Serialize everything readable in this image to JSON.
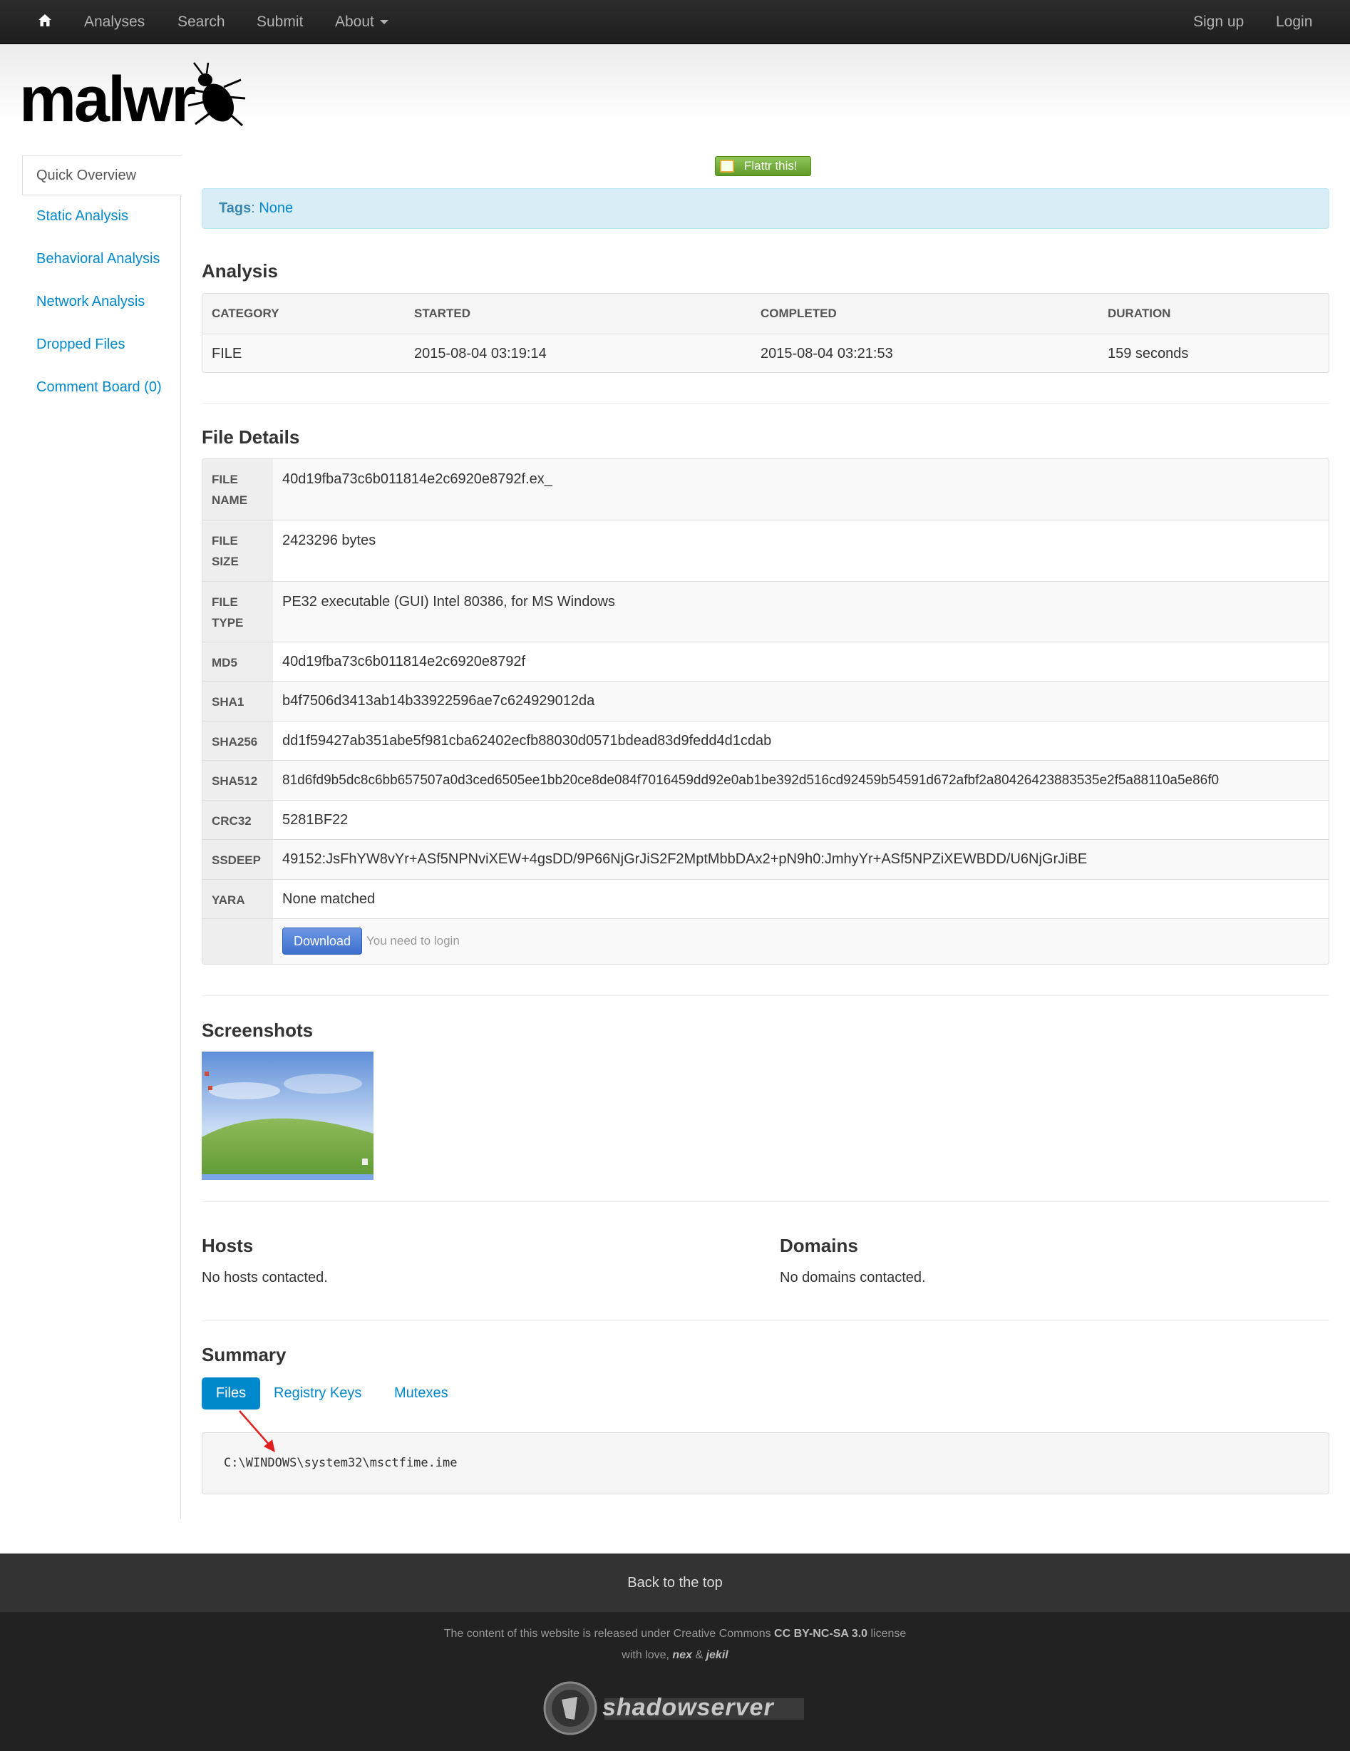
{
  "nav": {
    "left": [
      "Analyses",
      "Search",
      "Submit",
      "About"
    ],
    "right": [
      "Sign up",
      "Login"
    ]
  },
  "logo": {
    "text": "malwr"
  },
  "sidebar": {
    "active": "Quick Overview",
    "items": [
      "Static Analysis",
      "Behavioral Analysis",
      "Network Analysis",
      "Dropped Files",
      "Comment Board (0)"
    ]
  },
  "flattr": {
    "label": "Flattr this!"
  },
  "tags": {
    "label": "Tags",
    "value": "None"
  },
  "analysis": {
    "title": "Analysis",
    "headers": [
      "CATEGORY",
      "STARTED",
      "COMPLETED",
      "DURATION"
    ],
    "row": [
      "FILE",
      "2015-08-04 03:19:14",
      "2015-08-04 03:21:53",
      "159 seconds"
    ]
  },
  "file_details": {
    "title": "File Details",
    "file_name_label": [
      "FILE",
      "NAME"
    ],
    "file_name": "40d19fba73c6b011814e2c6920e8792f.ex_",
    "file_size_label": [
      "FILE",
      "SIZE"
    ],
    "file_size": "2423296 bytes",
    "file_type_label": [
      "FILE",
      "TYPE"
    ],
    "file_type": "PE32 executable (GUI) Intel 80386, for MS Windows",
    "md5_label": "MD5",
    "md5": "40d19fba73c6b011814e2c6920e8792f",
    "sha1_label": "SHA1",
    "sha1": "b4f7506d3413ab14b33922596ae7c624929012da",
    "sha256_label": "SHA256",
    "sha256": "dd1f59427ab351abe5f981cba62402ecfb88030d0571bdead83d9fedd4d1cdab",
    "sha512_label": "SHA512",
    "sha512": "81d6fd9b5dc8c6bb657507a0d3ced6505ee1bb20ce8de084f7016459dd92e0ab1be392d516cd92459b54591d672afbf2a80426423883535e2f5a88110a5e86f0",
    "crc32_label": "CRC32",
    "crc32": "5281BF22",
    "ssdeep_label": "SSDEEP",
    "ssdeep": "49152:JsFhYW8vYr+ASf5NPNviXEW+4gsDD/9P66NjGrJiS2F2MptMbbDAx2+pN9h0:JmhyYr+ASf5NPZiXEWBDD/U6NjGrJiBE",
    "yara_label": "YARA",
    "yara": "None matched",
    "download_label": "Download",
    "login_note": "You need to login"
  },
  "screenshots": {
    "title": "Screenshots"
  },
  "hosts": {
    "title": "Hosts",
    "text": "No hosts contacted."
  },
  "domains": {
    "title": "Domains",
    "text": "No domains contacted."
  },
  "summary": {
    "title": "Summary",
    "tabs": [
      "Files",
      "Registry Keys",
      "Mutexes"
    ],
    "file_path": "C:\\WINDOWS\\system32\\msctfime.ime"
  },
  "footer": {
    "back_to_top": "Back to the top",
    "license_prefix": "The content of this website is released under Creative Commons",
    "license_name": "CC BY-NC-SA 3.0",
    "license_suffix": "license",
    "love_prefix": "with love,",
    "author1": "nex",
    "amp": "&",
    "author2": "jekil",
    "sponsor": "shadowserver"
  },
  "colors": {
    "link": "#0088cc",
    "navbar": "#1e1e1e",
    "tags_bg": "#d9edf7",
    "tab_active": "#0088cc",
    "download": "#3d6fcf",
    "arrow": "#e02020"
  }
}
